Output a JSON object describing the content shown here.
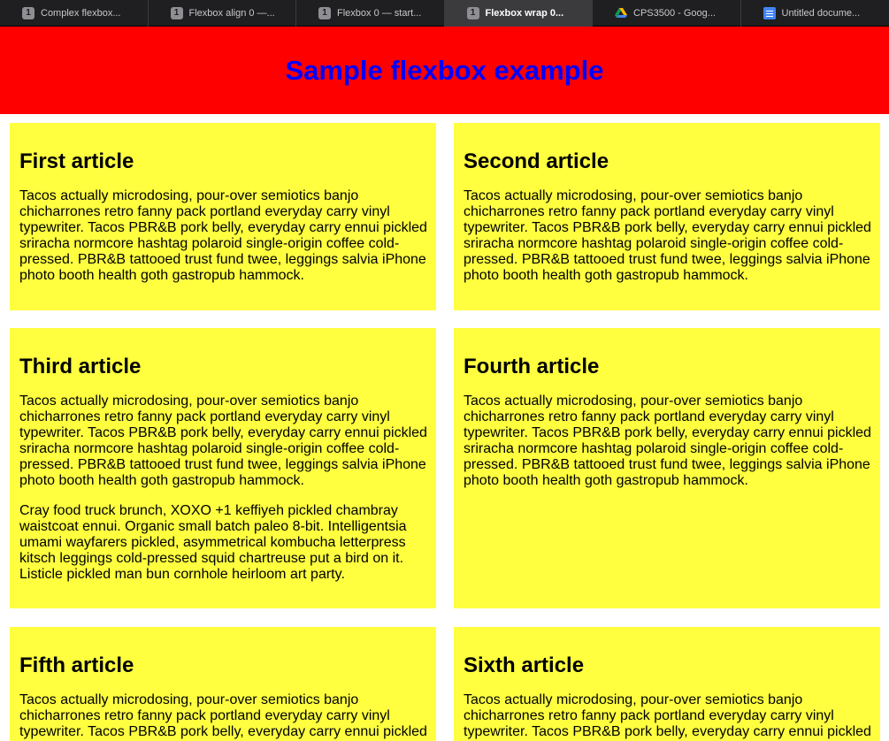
{
  "browser": {
    "tabs": [
      {
        "title": "Complex flexbox...",
        "favicon": "1",
        "active": false
      },
      {
        "title": "Flexbox align 0 —...",
        "favicon": "1",
        "active": false
      },
      {
        "title": "Flexbox 0 — start...",
        "favicon": "1",
        "active": false
      },
      {
        "title": "Flexbox wrap 0...",
        "favicon": "1",
        "active": true
      },
      {
        "title": "CPS3500 - Goog...",
        "favicon": "google-drive-icon",
        "active": false
      },
      {
        "title": "Untitled docume...",
        "favicon": "google-docs-icon",
        "active": false
      }
    ]
  },
  "header": {
    "title": "Sample flexbox example"
  },
  "articles": [
    {
      "title": "First article",
      "paragraphs": [
        "Tacos actually microdosing, pour-over semiotics banjo chicharrones retro fanny pack portland everyday carry vinyl typewriter. Tacos PBR&B pork belly, everyday carry ennui pickled sriracha normcore hashtag polaroid single-origin coffee cold-pressed. PBR&B tattooed trust fund twee, leggings salvia iPhone photo booth health goth gastropub hammock."
      ]
    },
    {
      "title": "Second article",
      "paragraphs": [
        "Tacos actually microdosing, pour-over semiotics banjo chicharrones retro fanny pack portland everyday carry vinyl typewriter. Tacos PBR&B pork belly, everyday carry ennui pickled sriracha normcore hashtag polaroid single-origin coffee cold-pressed. PBR&B tattooed trust fund twee, leggings salvia iPhone photo booth health goth gastropub hammock."
      ]
    },
    {
      "title": "Third article",
      "paragraphs": [
        "Tacos actually microdosing, pour-over semiotics banjo chicharrones retro fanny pack portland everyday carry vinyl typewriter. Tacos PBR&B pork belly, everyday carry ennui pickled sriracha normcore hashtag polaroid single-origin coffee cold-pressed. PBR&B tattooed trust fund twee, leggings salvia iPhone photo booth health goth gastropub hammock.",
        "Cray food truck brunch, XOXO +1 keffiyeh pickled chambray waistcoat ennui. Organic small batch paleo 8-bit. Intelligentsia umami wayfarers pickled, asymmetrical kombucha letterpress kitsch leggings cold-pressed squid chartreuse put a bird on it. Listicle pickled man bun cornhole heirloom art party."
      ]
    },
    {
      "title": "Fourth article",
      "paragraphs": [
        "Tacos actually microdosing, pour-over semiotics banjo chicharrones retro fanny pack portland everyday carry vinyl typewriter. Tacos PBR&B pork belly, everyday carry ennui pickled sriracha normcore hashtag polaroid single-origin coffee cold-pressed. PBR&B tattooed trust fund twee, leggings salvia iPhone photo booth health goth gastropub hammock."
      ]
    },
    {
      "title": "Fifth article",
      "paragraphs": [
        "Tacos actually microdosing, pour-over semiotics banjo chicharrones retro fanny pack portland everyday carry vinyl typewriter. Tacos PBR&B pork belly, everyday carry ennui pickled"
      ]
    },
    {
      "title": "Sixth article",
      "paragraphs": [
        "Tacos actually microdosing, pour-over semiotics banjo chicharrones retro fanny pack portland everyday carry vinyl typewriter. Tacos PBR&B pork belly, everyday carry ennui pickled"
      ]
    }
  ],
  "colors": {
    "header_bg": "#ff0000",
    "header_text": "#0000ff",
    "article_bg": "#ffff40"
  }
}
